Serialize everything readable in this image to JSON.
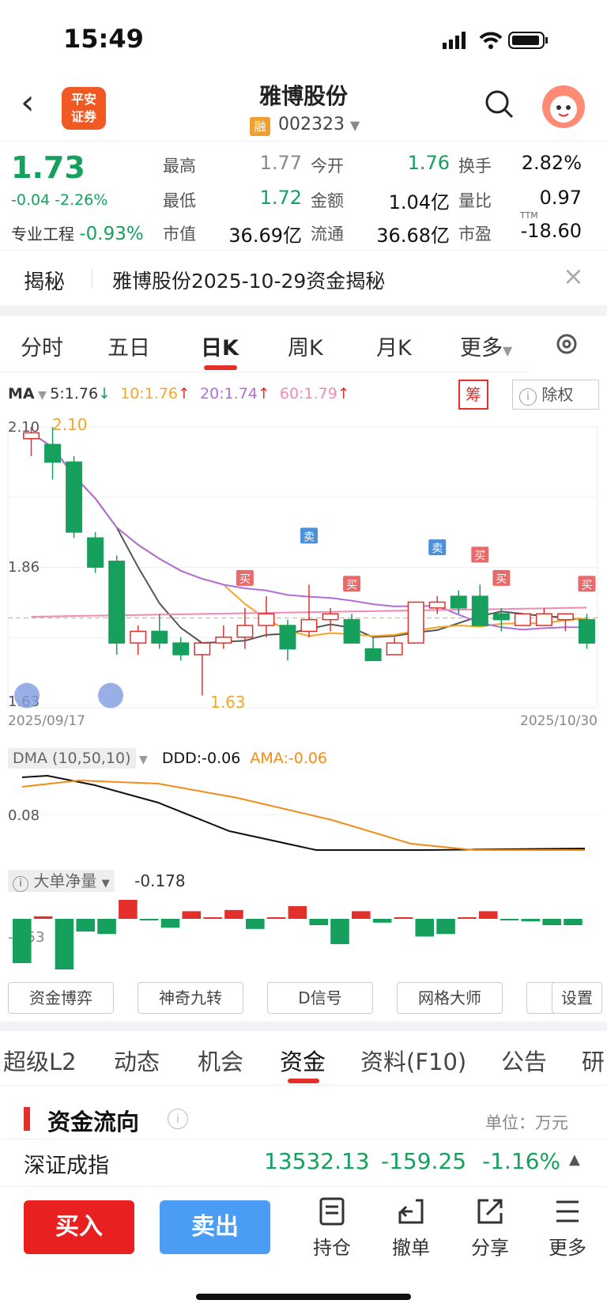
{
  "status": {
    "time": "15:49"
  },
  "header": {
    "title": "雅博股份",
    "code": "002323",
    "rong": "融",
    "logo_line1": "平安",
    "logo_line2": "证券"
  },
  "quote": {
    "price": "1.73",
    "change": "-0.04 -2.26%",
    "sector_label": "专业工程",
    "sector_change": "-0.93%",
    "items": [
      {
        "label": "最高",
        "value": "1.77"
      },
      {
        "label": "今开",
        "value": "1.76"
      },
      {
        "label": "换手",
        "value": "2.82%"
      },
      {
        "label": "最低",
        "value": "1.72"
      },
      {
        "label": "金额",
        "value": "1.04亿"
      },
      {
        "label": "量比",
        "value": "0.97"
      },
      {
        "label": "市值",
        "value": "36.69亿"
      },
      {
        "label": "流通",
        "value": "36.68亿"
      },
      {
        "label": "市盈",
        "value": "-18.60"
      }
    ],
    "ttm": "TTM"
  },
  "reveal": {
    "label": "揭秘",
    "text": "雅博股份2025-10-29资金揭秘"
  },
  "chart_tabs": [
    "分时",
    "五日",
    "日K",
    "周K",
    "月K",
    "更多"
  ],
  "ma_legend": {
    "label": "MA",
    "ma5": "5:1.76",
    "ma10": "10:1.76",
    "ma20": "20:1.74",
    "ma60": "60:1.79",
    "chou": "筹",
    "fuquan": "除权"
  },
  "chart_data": {
    "type": "candlestick",
    "start_date": "2025/09/17",
    "end_date": "2025/10/30",
    "y_ticks": [
      "2.10",
      "1.86",
      "1.63"
    ],
    "high_label": "2.10",
    "low_label": "1.63",
    "ylim": [
      1.63,
      2.1
    ],
    "candles": [
      {
        "o": 2.08,
        "c": 2.09,
        "h": 2.1,
        "l": 2.05
      },
      {
        "o": 2.07,
        "c": 2.04,
        "h": 2.1,
        "l": 2.01
      },
      {
        "o": 2.04,
        "c": 1.92,
        "h": 2.05,
        "l": 1.91
      },
      {
        "o": 1.91,
        "c": 1.86,
        "h": 1.92,
        "l": 1.85
      },
      {
        "o": 1.87,
        "c": 1.73,
        "h": 1.88,
        "l": 1.71
      },
      {
        "o": 1.73,
        "c": 1.75,
        "h": 1.76,
        "l": 1.71
      },
      {
        "o": 1.75,
        "c": 1.73,
        "h": 1.78,
        "l": 1.72
      },
      {
        "o": 1.73,
        "c": 1.71,
        "h": 1.74,
        "l": 1.7
      },
      {
        "o": 1.71,
        "c": 1.73,
        "h": 1.73,
        "l": 1.64
      },
      {
        "o": 1.73,
        "c": 1.74,
        "h": 1.76,
        "l": 1.72
      },
      {
        "o": 1.74,
        "c": 1.76,
        "h": 1.79,
        "l": 1.72
      },
      {
        "o": 1.76,
        "c": 1.78,
        "h": 1.81,
        "l": 1.74
      },
      {
        "o": 1.76,
        "c": 1.72,
        "h": 1.77,
        "l": 1.7
      },
      {
        "o": 1.75,
        "c": 1.77,
        "h": 1.83,
        "l": 1.74
      },
      {
        "o": 1.77,
        "c": 1.78,
        "h": 1.79,
        "l": 1.75
      },
      {
        "o": 1.77,
        "c": 1.73,
        "h": 1.78,
        "l": 1.73
      },
      {
        "o": 1.72,
        "c": 1.7,
        "h": 1.74,
        "l": 1.7
      },
      {
        "o": 1.71,
        "c": 1.73,
        "h": 1.74,
        "l": 1.71
      },
      {
        "o": 1.73,
        "c": 1.8,
        "h": 1.8,
        "l": 1.73
      },
      {
        "o": 1.79,
        "c": 1.8,
        "h": 1.81,
        "l": 1.78
      },
      {
        "o": 1.81,
        "c": 1.79,
        "h": 1.82,
        "l": 1.78
      },
      {
        "o": 1.81,
        "c": 1.76,
        "h": 1.83,
        "l": 1.76
      },
      {
        "o": 1.78,
        "c": 1.77,
        "h": 1.79,
        "l": 1.75
      },
      {
        "o": 1.76,
        "c": 1.78,
        "h": 1.78,
        "l": 1.76
      },
      {
        "o": 1.76,
        "c": 1.78,
        "h": 1.79,
        "l": 1.76
      },
      {
        "o": 1.77,
        "c": 1.78,
        "h": 1.78,
        "l": 1.75
      },
      {
        "o": 1.77,
        "c": 1.73,
        "h": 1.78,
        "l": 1.72
      }
    ],
    "signals": [
      {
        "i": 10,
        "t": "买"
      },
      {
        "i": 13,
        "t": "卖"
      },
      {
        "i": 15,
        "t": "买"
      },
      {
        "i": 19,
        "t": "卖"
      },
      {
        "i": 21,
        "t": "买"
      },
      {
        "i": 22,
        "t": "买"
      },
      {
        "i": 26,
        "t": "买"
      }
    ]
  },
  "dma": {
    "label": "DMA (10,50,10)",
    "ddd": "DDD:-0.06",
    "ama": "AMA:-0.06",
    "tick": "0.08"
  },
  "big_order": {
    "label": "大单净量",
    "value": "-0.178",
    "tick": "-.353",
    "bars": [
      -0.35,
      0.02,
      -0.4,
      -0.1,
      -0.12,
      0.15,
      -0.01,
      -0.07,
      0.06,
      0.0,
      0.07,
      -0.08,
      0.0,
      0.1,
      -0.05,
      -0.2,
      0.06,
      -0.03,
      0.01,
      -0.14,
      -0.12,
      0.0,
      0.06,
      -0.01,
      -0.02,
      -0.05,
      -0.05
    ]
  },
  "tools": [
    "资金博弈",
    "神奇九转",
    "D信号",
    "网格大师",
    "设置"
  ],
  "bottom_tabs": [
    "超级L2",
    "动态",
    "机会",
    "资金",
    "资料(F10)",
    "公告",
    "研"
  ],
  "flow": {
    "title": "资金流向",
    "unit": "单位：万元"
  },
  "index": {
    "name": "深证成指",
    "value": "13532.13",
    "change": "-159.25",
    "pct": "-1.16%"
  },
  "actions": {
    "buy": "买入",
    "sell": "卖出",
    "hold": "持仓",
    "cancel": "撤单",
    "share": "分享",
    "more": "更多"
  }
}
